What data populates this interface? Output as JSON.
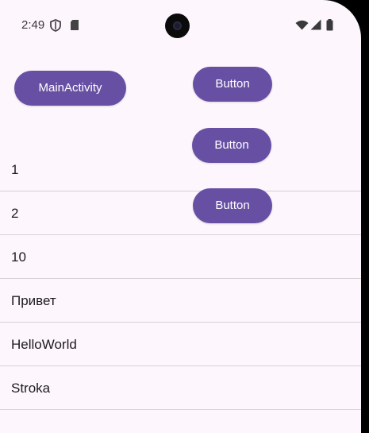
{
  "status_bar": {
    "time": "2:49"
  },
  "buttons": {
    "main_activity": "MainActivity",
    "button_1": "Button",
    "button_2": "Button",
    "button_3": "Button"
  },
  "list": {
    "items": [
      "1",
      "2",
      "10",
      "Привет",
      "HelloWorld",
      "Stroka"
    ]
  },
  "colors": {
    "primary": "#6750a4",
    "background": "#fdf6fd",
    "divider": "#d6d2d6"
  },
  "icons": [
    "shield-icon",
    "sd-card-icon",
    "front-camera-icon",
    "wifi-icon",
    "signal-icon",
    "battery-icon"
  ]
}
